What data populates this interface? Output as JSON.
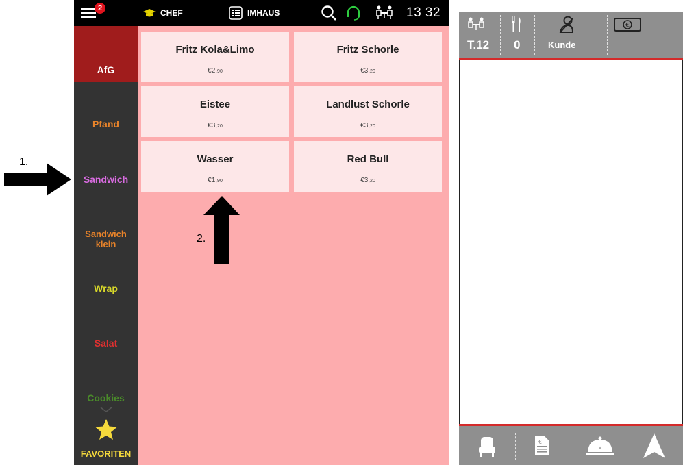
{
  "topbar": {
    "menu_badge": "2",
    "user_label": "CHEF",
    "mode_label": "IMHAUS",
    "time": "13 32",
    "icons": [
      "hamburger-menu-icon",
      "graduation-cap-icon",
      "list-icon",
      "search-icon",
      "headset-icon",
      "table-people-icon"
    ]
  },
  "sidebar": {
    "items": [
      {
        "label": "AfG",
        "color": "#ffffff",
        "active": true
      },
      {
        "label": "Pfand",
        "color": "#e8832a"
      },
      {
        "label": "Sandwich",
        "color": "#d86be0"
      },
      {
        "label": "Sandwich klein",
        "color": "#e8832a"
      },
      {
        "label": "Wrap",
        "color": "#d8d82a"
      },
      {
        "label": "Salat",
        "color": "#e03030"
      },
      {
        "label": "Cookies",
        "color": "#4a8a2a"
      }
    ],
    "favorites_label": "FAVORITEN"
  },
  "products": [
    {
      "name": "Fritz Kola&Limo",
      "price_main": "€2,",
      "price_cents": "90"
    },
    {
      "name": "Fritz Schorle",
      "price_main": "€3,",
      "price_cents": "20"
    },
    {
      "name": "Eistee",
      "price_main": "€3,",
      "price_cents": "20"
    },
    {
      "name": "Landlust Schorle",
      "price_main": "€3,",
      "price_cents": "20"
    },
    {
      "name": "Wasser",
      "price_main": "€1,",
      "price_cents": "90"
    },
    {
      "name": "Red Bull",
      "price_main": "€3,",
      "price_cents": "20"
    }
  ],
  "order_panel": {
    "table_label": "T.12",
    "guests": "0",
    "customer_label": "Kunde",
    "header_icons": [
      "table-people-icon",
      "cutlery-icon",
      "customer-icon",
      "cash-icon"
    ],
    "footer_icons": [
      "seat-icon",
      "receipt-icon",
      "cloche-icon",
      "send-arrow-icon"
    ]
  },
  "annotations": {
    "label_1": "1.",
    "label_2": "2."
  },
  "colors": {
    "topbar": "#000000",
    "sidebar": "#333333",
    "active_category": "#a01c1c",
    "product_area": "#fdacae",
    "product_tile": "#fde7e8",
    "panel_gray": "#8f8f8f",
    "accent_red": "#d42a2a"
  }
}
